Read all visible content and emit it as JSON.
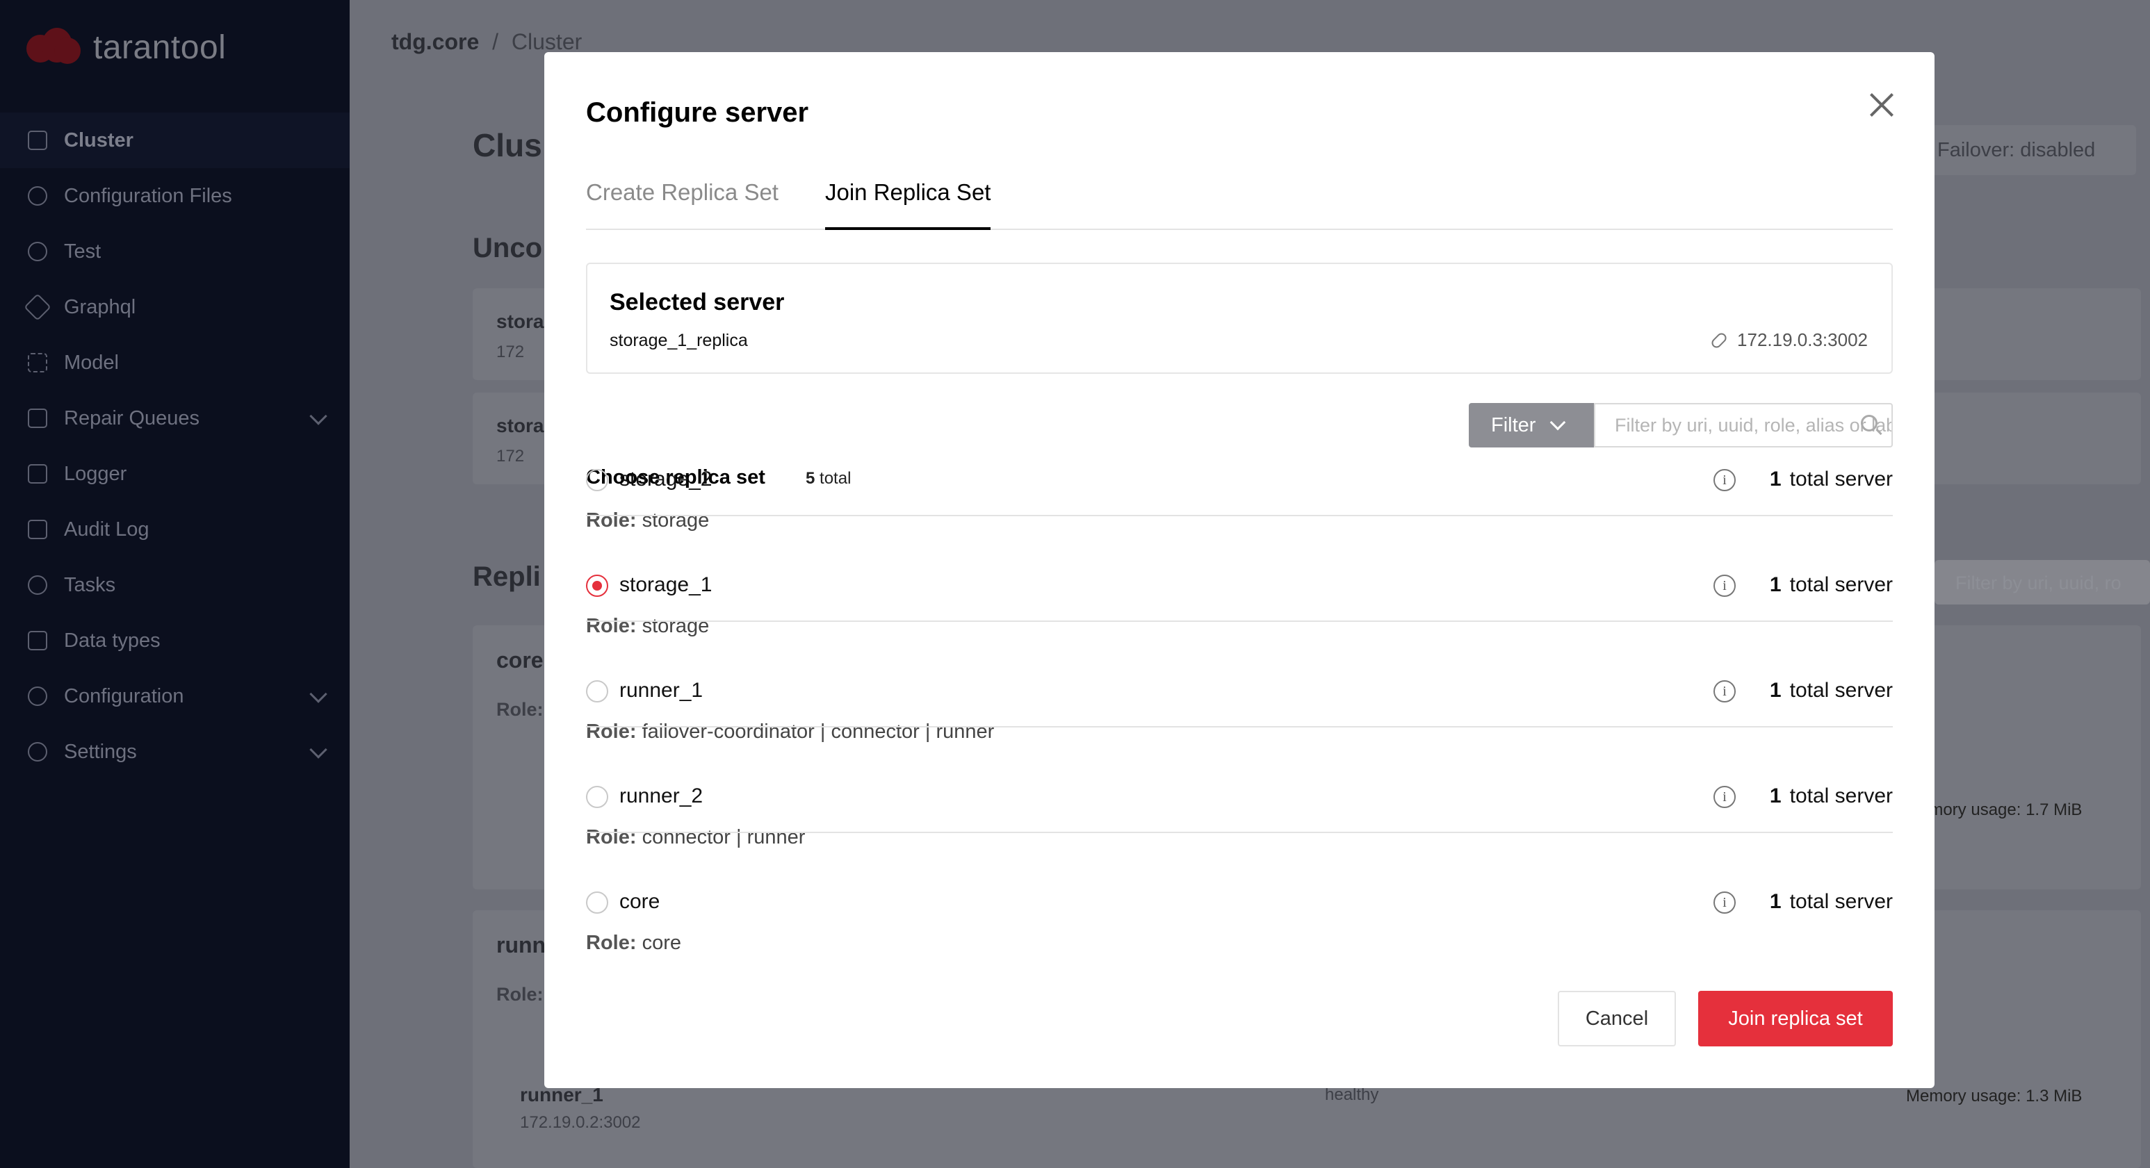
{
  "app": {
    "brand": "tarantool"
  },
  "colors": {
    "accent": "#e5303c",
    "sidebar_bg": "#0b0f1e",
    "overlay": "#6e7079"
  },
  "sidebar": {
    "items": [
      {
        "label": "Cluster",
        "icon": "cluster-icon",
        "active": true
      },
      {
        "label": "Configuration Files",
        "icon": "gear-icon"
      },
      {
        "label": "Test",
        "icon": "test-icon"
      },
      {
        "label": "Graphql",
        "icon": "graphql-icon"
      },
      {
        "label": "Model",
        "icon": "braces-icon"
      },
      {
        "label": "Repair Queues",
        "icon": "wrench-icon",
        "expandable": true
      },
      {
        "label": "Logger",
        "icon": "log-icon"
      },
      {
        "label": "Audit Log",
        "icon": "audit-icon"
      },
      {
        "label": "Tasks",
        "icon": "clock-icon"
      },
      {
        "label": "Data types",
        "icon": "datatypes-icon"
      },
      {
        "label": "Configuration",
        "icon": "share-icon",
        "expandable": true
      },
      {
        "label": "Settings",
        "icon": "gear-icon",
        "expandable": true
      }
    ]
  },
  "background": {
    "breadcrumb_app": "tdg.core",
    "breadcrumb_sep": "/",
    "breadcrumb_page": "Cluster",
    "page_title_fragment": "Clus",
    "failover": "Failover: disabled",
    "unconfigured_fragment": "Unco",
    "replicasets_fragment": "Repli",
    "card1_name": "stora",
    "card1_uri": "172",
    "card2_name": "stora",
    "card2_uri": "172",
    "core_fragment": "core",
    "role_fragment1": "Role:",
    "runner_fragment": "runn",
    "role_fragment2": "Role:",
    "filter_placeholder": "Filter by uri, uuid, ro",
    "memory1": "Memory usage: 1.7 MiB",
    "memory2": "Memory usage: 1.3 MiB",
    "runner_server": "runner_1",
    "runner_server_uri": "172.19.0.2:3002",
    "runner_status": "healthy"
  },
  "modal": {
    "title": "Configure server",
    "tabs": {
      "create": "Create Replica Set",
      "join": "Join Replica Set"
    },
    "selected_server": {
      "heading": "Selected server",
      "alias": "storage_1_replica",
      "uri": "172.19.0.3:3002"
    },
    "choose_label": "Choose replica set",
    "total_count": "5",
    "total_word": "total",
    "filter_label": "Filter",
    "filter_placeholder": "Filter by uri, uuid, role, alias or labels",
    "role_label": "Role:",
    "replica_sets": [
      {
        "name": "storage_2",
        "count": "1",
        "count_label": "total server",
        "roles": "storage",
        "selected": false
      },
      {
        "name": "storage_1",
        "count": "1",
        "count_label": "total server",
        "roles": "storage",
        "selected": true
      },
      {
        "name": "runner_1",
        "count": "1",
        "count_label": "total server",
        "roles": "failover-coordinator | connector | runner",
        "selected": false
      },
      {
        "name": "runner_2",
        "count": "1",
        "count_label": "total server",
        "roles": "connector | runner",
        "selected": false
      },
      {
        "name": "core",
        "count": "1",
        "count_label": "total server",
        "roles": "core",
        "selected": false
      }
    ],
    "cancel_label": "Cancel",
    "submit_label": "Join replica set"
  }
}
